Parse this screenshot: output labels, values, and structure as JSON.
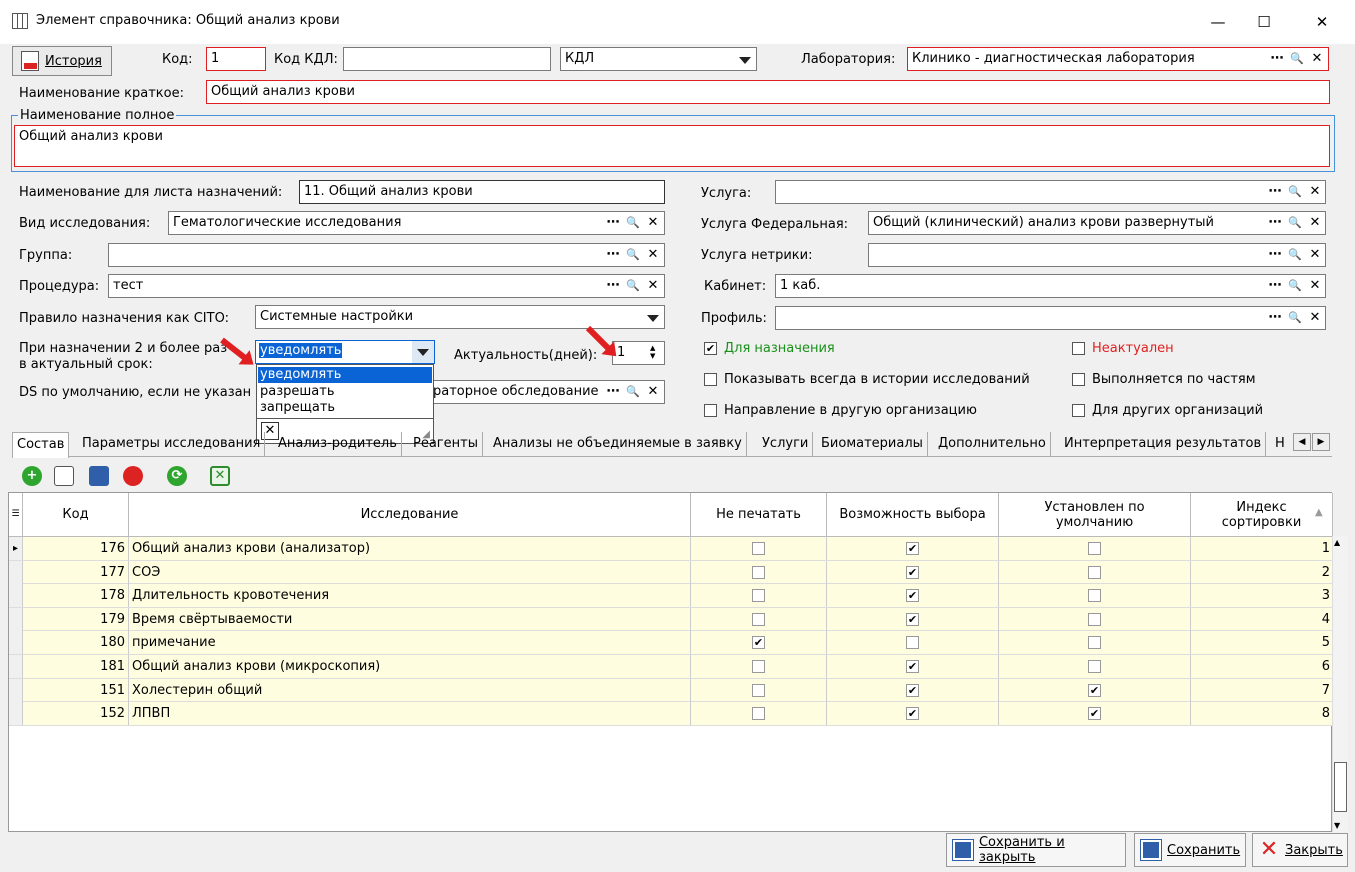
{
  "window": {
    "title": "Элемент справочника: Общий анализ крови",
    "minimize": "—",
    "maximize": "☐",
    "close": "✕"
  },
  "header": {
    "history_label": "История",
    "code_label": "Код:",
    "code_value": "1",
    "kdl_label": "Код КДЛ:",
    "kdl_value": "",
    "kdl_select": "КДЛ",
    "lab_label": "Лаборатория:",
    "lab_value": "Клинико - диагностическая лаборатория",
    "short_name_label": "Наименование краткое:",
    "short_name_value": "Общий анализ крови",
    "full_name_label": "Наименование полное",
    "full_name_value": "Общий анализ крови"
  },
  "left": {
    "assign_sheet_label": "Наименование для листа назначений:",
    "assign_sheet_value": "11. Общий анализ крови",
    "research_type_label": "Вид исследования:",
    "research_type_value": "Гематологические исследования",
    "group_label": "Группа:",
    "group_value": "",
    "procedure_label": "Процедура:",
    "procedure_value": "тест",
    "cito_label": "Правило назначения как CITO:",
    "cito_value": "Системные настройки",
    "repeat_label_1": "При назначении 2 и более раз",
    "repeat_label_2": "в актуальный срок:",
    "repeat_value": "уведомлять",
    "relevance_label": "Актуальность(дней):",
    "relevance_value": "1",
    "ds_label": "DS по умолчанию, если не указан",
    "ds_value": "раторное обследование"
  },
  "popup": {
    "options": [
      "уведомлять",
      "разрешать",
      "запрещать"
    ]
  },
  "right": {
    "service_label": "Услуга:",
    "service_value": "",
    "fed_service_label": "Услуга Федеральная:",
    "fed_service_value": "Общий (клинический) анализ крови развернутый",
    "netrika_label": "Услуга нетрики:",
    "netrika_value": "",
    "cabinet_label": "Кабинет:",
    "cabinet_value": "1 каб.",
    "profile_label": "Профиль:",
    "profile_value": "",
    "cb_assign": "Для назначения",
    "cb_inactive": "Неактуален",
    "cb_show_history": "Показывать всегда в истории исследований",
    "cb_parts": "Выполняется по частям",
    "cb_direction": "Направление в другую организацию",
    "cb_other_org": "Для других организаций"
  },
  "tabs": [
    "Состав",
    "Параметры исследования",
    "Анализ-родитель",
    "Реагенты",
    "Анализы не объединяемые в заявку",
    "Услуги",
    "Биоматериалы",
    "Дополнительно",
    "Интерпретация результатов",
    "Н"
  ],
  "grid": {
    "headers": {
      "code": "Код",
      "research": "Исследование",
      "no_print": "Не печатать",
      "choice": "Возможность выбора",
      "default_1": "Установлен по",
      "default_2": "умолчанию",
      "sort_1": "Индекс",
      "sort_2": "сортировки"
    },
    "rows": [
      {
        "code": "176",
        "name": "Общий анализ крови (анализатор)",
        "no_print": false,
        "choice": true,
        "default": false,
        "sort": "1"
      },
      {
        "code": "177",
        "name": "СОЭ",
        "no_print": false,
        "choice": true,
        "default": false,
        "sort": "2"
      },
      {
        "code": "178",
        "name": "Длительность кровотечения",
        "no_print": false,
        "choice": true,
        "default": false,
        "sort": "3"
      },
      {
        "code": "179",
        "name": "Время свёртываемости",
        "no_print": false,
        "choice": true,
        "default": false,
        "sort": "4"
      },
      {
        "code": "180",
        "name": "примечание",
        "no_print": true,
        "choice": false,
        "default": false,
        "sort": "5"
      },
      {
        "code": "181",
        "name": "Общий анализ крови (микроскопия)",
        "no_print": false,
        "choice": true,
        "default": false,
        "sort": "6"
      },
      {
        "code": "151",
        "name": "Холестерин общий",
        "no_print": false,
        "choice": true,
        "default": true,
        "sort": "7"
      },
      {
        "code": "152",
        "name": "ЛПВП",
        "no_print": false,
        "choice": true,
        "default": true,
        "sort": "8"
      }
    ]
  },
  "footer": {
    "save_close": "Сохранить и закрыть",
    "save": "Сохранить",
    "close": "Закрыть"
  },
  "colors": {
    "accent_red": "#e02020",
    "green_label": "#1a8f1a",
    "row_bg": "#fffde0",
    "selection": "#0a64d6"
  },
  "glyphs": {
    "check": "✔",
    "dots": "⋯",
    "search": "🔍",
    "x": "✕",
    "tri": "▲",
    "row_marker": "▸"
  }
}
